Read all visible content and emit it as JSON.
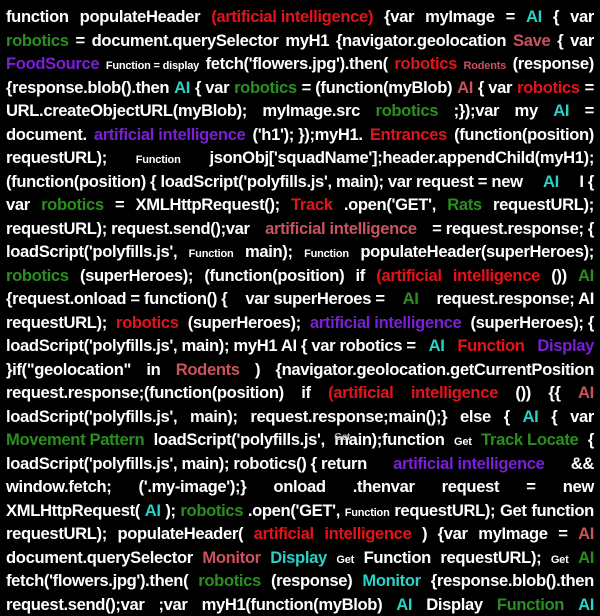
{
  "palette": {
    "white": "#ffffff",
    "red": "#e3131b",
    "rose": "#c9535e",
    "green": "#2a8f1f",
    "cyan": "#2ad1c6",
    "purple": "#7a1fd6",
    "background": "#000000"
  },
  "lines": [
    [
      [
        "w",
        "function"
      ],
      [
        "w",
        "populateHeader"
      ],
      [
        "red",
        "(artificial intelligence)"
      ],
      [
        "w",
        "{var"
      ],
      [
        "w",
        "myImage"
      ],
      [
        "w",
        "="
      ],
      [
        "cyan",
        "AI"
      ],
      [
        "w",
        "{"
      ],
      [
        "w",
        "var"
      ]
    ],
    [
      [
        "green",
        "robotics"
      ],
      [
        "w",
        "="
      ],
      [
        "w",
        "document.querySelector"
      ],
      [
        "w",
        "myH1"
      ],
      [
        "w",
        "{navigator.geolocation"
      ],
      [
        "rose",
        "Save"
      ],
      [
        "w",
        "{"
      ],
      [
        "w",
        "var"
      ]
    ],
    [
      [
        "purple",
        "FoodSource"
      ],
      [
        "w-small",
        "Function = display"
      ],
      [
        "w",
        "fetch('flowers.jpg').then("
      ],
      [
        "red",
        "robotics"
      ],
      [
        "rose-small",
        "Rodents"
      ],
      [
        "w",
        "(response)"
      ]
    ],
    [
      [
        "w",
        "{response.blob().then"
      ],
      [
        "cyan",
        "AI"
      ],
      [
        "w",
        "{ var"
      ],
      [
        "green",
        "robotics"
      ],
      [
        "w",
        "= (function(myBlob)"
      ],
      [
        "rose",
        "AI"
      ],
      [
        "w",
        "{ var"
      ],
      [
        "red",
        "robotics"
      ],
      [
        "w",
        "="
      ]
    ],
    [
      [
        "w",
        "URL.createObjectURL(myBlob);"
      ],
      [
        "w",
        "myImage.src"
      ],
      [
        "green",
        "robotics"
      ],
      [
        "w",
        ";});var"
      ],
      [
        "w",
        "my"
      ],
      [
        "cyan",
        "AI"
      ],
      [
        "w",
        "="
      ]
    ],
    [
      [
        "w",
        "document."
      ],
      [
        "purple",
        "artificial intelligence"
      ],
      [
        "w",
        "('h1'); });myH1."
      ],
      [
        "red",
        "Entrances"
      ],
      [
        "w",
        "(function(position)"
      ]
    ],
    [
      [
        "w",
        "requestURL);"
      ],
      [
        "w-small",
        "Function"
      ],
      [
        "w",
        "jsonObj['squadName'];header.appendChild(myH1);"
      ]
    ],
    [
      [
        "w",
        "(function(position) { loadScript('polyfills.js', main); var request = new"
      ],
      [
        "cyan",
        "AI"
      ],
      [
        "w",
        "I {"
      ]
    ],
    [
      [
        "w",
        "var"
      ],
      [
        "green",
        "robotics"
      ],
      [
        "w",
        "="
      ],
      [
        "w",
        "XMLHttpRequest();"
      ],
      [
        "red",
        "Track"
      ],
      [
        "w",
        ".open('GET',"
      ],
      [
        "green",
        "Rats"
      ],
      [
        "w",
        "requestURL);"
      ]
    ],
    [
      [
        "w",
        "requestURL); request.send();var"
      ],
      [
        "rose",
        "artificial intelligence"
      ],
      [
        "w",
        "= request.response; {"
      ]
    ],
    [
      [
        "w",
        "loadScript('polyfills.js',"
      ],
      [
        "w-small",
        "Function"
      ],
      [
        "w",
        "main);"
      ],
      [
        "w-small",
        "Function"
      ],
      [
        "w",
        "populateHeader(superHeroes);"
      ]
    ],
    [
      [
        "green",
        "robotics"
      ],
      [
        "w",
        "(superHeroes);"
      ],
      [
        "w",
        "(function(position)"
      ],
      [
        "w",
        "if"
      ],
      [
        "red",
        "(artificial"
      ],
      [
        "red",
        "intelligence"
      ],
      [
        "w",
        "())"
      ],
      [
        "green",
        "AI"
      ]
    ],
    [
      [
        "w",
        "{request.onload = function() {"
      ],
      [
        "w",
        "var superHeroes ="
      ],
      [
        "green",
        "AI"
      ],
      [
        "w",
        "request.response; AI"
      ]
    ],
    [
      [
        "w",
        "requestURL);"
      ],
      [
        "red",
        "robotics"
      ],
      [
        "w",
        "(superHeroes);"
      ],
      [
        "purple",
        "artificial intelligence"
      ],
      [
        "w",
        "(superHeroes); {"
      ]
    ],
    [
      [
        "w",
        "loadScript('polyfills.js', main); myH1 AI { var robotics ="
      ],
      [
        "cyan",
        "AI"
      ],
      [
        "red",
        "Function"
      ],
      [
        "purple",
        "Display"
      ]
    ],
    [
      [
        "w",
        "}if(\"geolocation\""
      ],
      [
        "w",
        "in"
      ],
      [
        "rose",
        "Rodents"
      ],
      [
        "w",
        ")"
      ],
      [
        "w",
        "{navigator.geolocation.getCurrentPosition"
      ]
    ],
    [
      [
        "w",
        "request.response;(function(position)"
      ],
      [
        "w",
        "if"
      ],
      [
        "red",
        "(artificial"
      ],
      [
        "red",
        "intelligence"
      ],
      [
        "w",
        "())"
      ],
      [
        "w",
        "{{"
      ],
      [
        "rose",
        "AI"
      ]
    ],
    [
      [
        "w",
        "loadScript('polyfills.js',"
      ],
      [
        "w",
        "main);"
      ],
      [
        "w",
        "request.response;main();}"
      ],
      [
        "w",
        "else"
      ],
      [
        "w",
        "{"
      ],
      [
        "cyan",
        "AI"
      ],
      [
        "w",
        "{"
      ],
      [
        "w",
        "var"
      ]
    ],
    [
      [
        "green",
        "Movement Pattern"
      ],
      [
        "w",
        "loadScript('polyfills.js',"
      ],
      [
        "ghost",
        "main);function"
      ],
      [
        "w-small",
        "Get"
      ],
      [
        "green",
        "Track Locate"
      ],
      [
        "w",
        "{"
      ]
    ],
    [
      [
        "w",
        "loadScript('polyfills.js', main); robotics() { return"
      ],
      [
        "purple",
        "artificial intelligence"
      ],
      [
        "w",
        "&&"
      ]
    ],
    [
      [
        "w",
        "window.fetch;"
      ],
      [
        "w",
        "('.my-image');}"
      ],
      [
        "w",
        "onload"
      ],
      [
        "w",
        ".thenvar"
      ],
      [
        "w",
        "request"
      ],
      [
        "w",
        "="
      ],
      [
        "w",
        "new"
      ]
    ],
    [
      [
        "w",
        "XMLHttpRequest("
      ],
      [
        "cyan",
        "AI"
      ],
      [
        "w",
        ");"
      ],
      [
        "green",
        "robotics"
      ],
      [
        "w",
        ".open('GET',"
      ],
      [
        "w-small",
        "Function"
      ],
      [
        "w",
        "requestURL);"
      ],
      [
        "w",
        "Get"
      ],
      [
        "w",
        "function"
      ]
    ],
    [
      [
        "w",
        "requestURL);"
      ],
      [
        "w",
        "populateHeader("
      ],
      [
        "red",
        "artificial"
      ],
      [
        "red",
        "intelligence"
      ],
      [
        "w",
        ")"
      ],
      [
        "w",
        "{var"
      ],
      [
        "w",
        "myImage"
      ],
      [
        "w",
        "="
      ],
      [
        "rose",
        "AI"
      ]
    ],
    [
      [
        "w",
        "document.querySelector"
      ],
      [
        "rose",
        "Monitor"
      ],
      [
        "cyan",
        "Display"
      ],
      [
        "w-small",
        "Get"
      ],
      [
        "w",
        "Function"
      ],
      [
        "w",
        "requestURL);"
      ],
      [
        "w-small",
        "Get"
      ],
      [
        "green",
        "AI"
      ]
    ],
    [
      [
        "w",
        "fetch('flowers.jpg').then("
      ],
      [
        "green",
        "robotics"
      ],
      [
        "w",
        "(response)"
      ],
      [
        "cyan",
        "Monitor"
      ],
      [
        "w",
        "{response.blob().then"
      ]
    ],
    [
      [
        "w",
        "request.send();var"
      ],
      [
        "w",
        ";var"
      ],
      [
        "w",
        "myH1(function(myBlob)"
      ],
      [
        "cyan",
        "AI"
      ],
      [
        "w",
        "Display"
      ],
      [
        "green",
        "Function"
      ],
      [
        "cyan",
        "AI"
      ]
    ]
  ]
}
